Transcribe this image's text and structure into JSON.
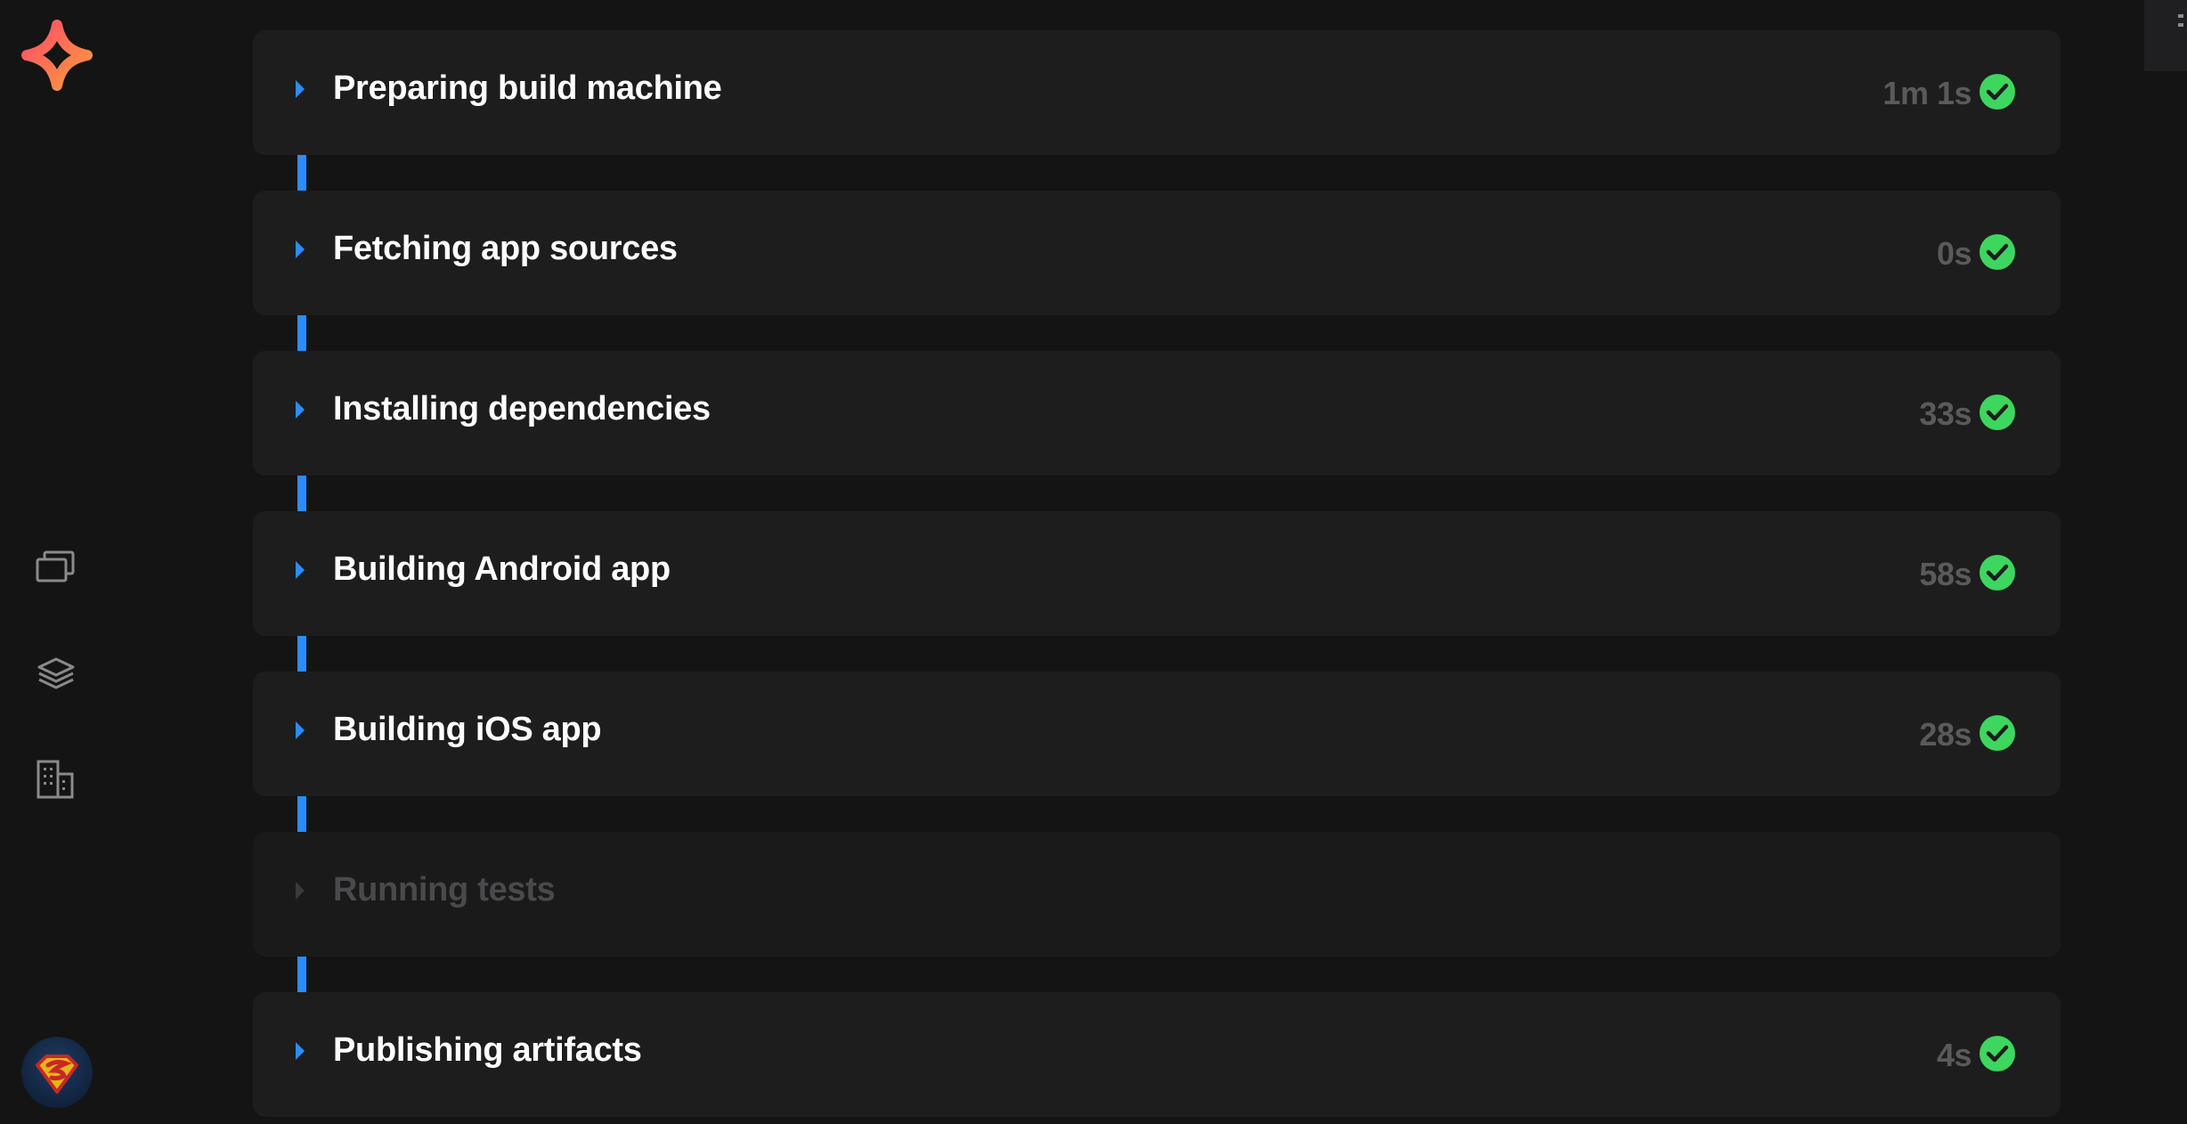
{
  "steps": [
    {
      "title": "Preparing build machine",
      "duration": "1m 1s",
      "status": "success"
    },
    {
      "title": "Fetching app sources",
      "duration": "0s",
      "status": "success"
    },
    {
      "title": "Installing dependencies",
      "duration": "33s",
      "status": "success"
    },
    {
      "title": "Building Android app",
      "duration": "58s",
      "status": "success"
    },
    {
      "title": "Building iOS app",
      "duration": "28s",
      "status": "success"
    },
    {
      "title": "Running tests",
      "duration": "",
      "status": "skipped"
    },
    {
      "title": "Publishing artifacts",
      "duration": "4s",
      "status": "success"
    }
  ],
  "sidebar": {
    "icons": [
      "apps-icon",
      "layers-icon",
      "building-icon"
    ],
    "avatar": "user-avatar"
  },
  "colors": {
    "accent": "#2a8cff",
    "success": "#3dd65f",
    "background": "#141414",
    "card": "#1d1d1e"
  }
}
